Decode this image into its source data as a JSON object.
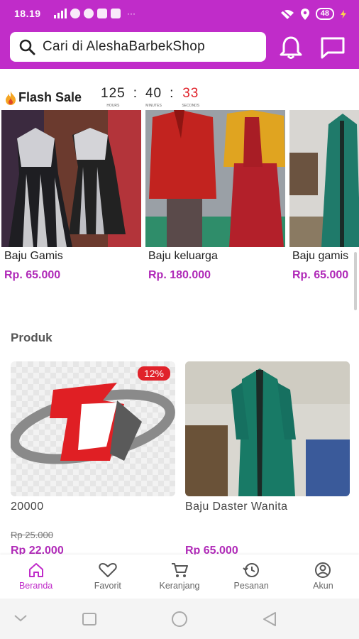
{
  "status_bar": {
    "time": "18.19",
    "battery": "48"
  },
  "header": {
    "search_placeholder": "Cari di AleshaBarbekShop"
  },
  "flash_sale": {
    "title": "Flash Sale",
    "timer": {
      "hours": "125",
      "minutes": "40",
      "seconds": "33",
      "hours_label": "HOURS",
      "minutes_label": "MINUTES",
      "seconds_label": "SECONDS"
    },
    "items": [
      {
        "name": "Baju Gamis",
        "price": "Rp. 65.000"
      },
      {
        "name": "Baju keluarga",
        "price": "Rp. 180.000"
      },
      {
        "name": "Baju gamis",
        "price": "Rp. 65.000"
      }
    ]
  },
  "produk": {
    "title": "Produk",
    "items": [
      {
        "name": "20000",
        "old_price": "Rp 25.000",
        "price": "Rp 22.000",
        "badge": "12%"
      },
      {
        "name": "Baju Daster Wanita",
        "price": "Rp 65.000"
      }
    ]
  },
  "bottom_nav": [
    {
      "label": "Beranda",
      "icon": "home-icon",
      "active": true
    },
    {
      "label": "Favorit",
      "icon": "heart-icon"
    },
    {
      "label": "Keranjang",
      "icon": "cart-icon"
    },
    {
      "label": "Pesanan",
      "icon": "history-icon"
    },
    {
      "label": "Akun",
      "icon": "account-icon"
    }
  ],
  "colors": {
    "brand": "#c02cc9",
    "price": "#b02ab8",
    "timer_seconds": "#e0222a",
    "badge": "#e0222a"
  }
}
